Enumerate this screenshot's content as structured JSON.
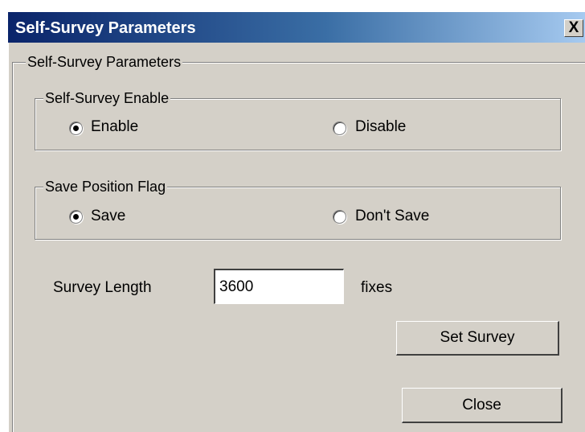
{
  "window": {
    "title": "Self-Survey Parameters",
    "close_glyph": "X"
  },
  "outer_group": {
    "label": "Self-Survey Parameters"
  },
  "enable_group": {
    "label": "Self-Survey Enable",
    "options": [
      {
        "label": "Enable",
        "checked": true
      },
      {
        "label": "Disable",
        "checked": false
      }
    ]
  },
  "save_group": {
    "label": "Save Position Flag",
    "options": [
      {
        "label": "Save",
        "checked": true
      },
      {
        "label": "Don't Save",
        "checked": false
      }
    ]
  },
  "survey_length": {
    "label": "Survey Length",
    "value": "3600",
    "unit": "fixes"
  },
  "buttons": {
    "set_survey": "Set Survey",
    "close": "Close"
  },
  "icons": {
    "close": "close-icon"
  }
}
